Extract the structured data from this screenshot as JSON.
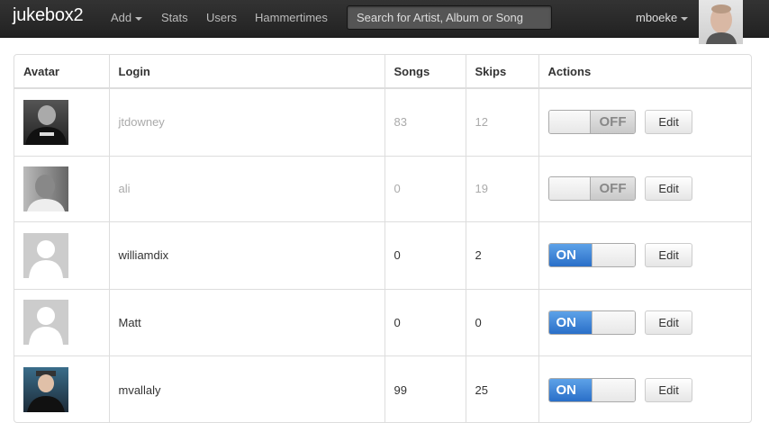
{
  "navbar": {
    "brand": "jukebox2",
    "add_label": "Add",
    "stats_label": "Stats",
    "users_label": "Users",
    "hammertimes_label": "Hammertimes",
    "search_placeholder": "Search for Artist, Album or Song",
    "username": "mboeke"
  },
  "table": {
    "headers": {
      "avatar": "Avatar",
      "login": "Login",
      "songs": "Songs",
      "skips": "Skips",
      "actions": "Actions"
    },
    "rows": [
      {
        "login": "jtdowney",
        "songs": "83",
        "skips": "12",
        "toggle": "OFF",
        "edit": "Edit"
      },
      {
        "login": "ali",
        "songs": "0",
        "skips": "19",
        "toggle": "OFF",
        "edit": "Edit"
      },
      {
        "login": "williamdix",
        "songs": "0",
        "skips": "2",
        "toggle": "ON",
        "edit": "Edit"
      },
      {
        "login": "Matt",
        "songs": "0",
        "skips": "0",
        "toggle": "ON",
        "edit": "Edit"
      },
      {
        "login": "mvallaly",
        "songs": "99",
        "skips": "25",
        "toggle": "ON",
        "edit": "Edit"
      }
    ]
  },
  "colors": {
    "navbar_bg": "#222222",
    "toggle_on": "#2a6fc8",
    "toggle_off": "#c9c9c9",
    "muted_text": "#aaaaaa"
  }
}
